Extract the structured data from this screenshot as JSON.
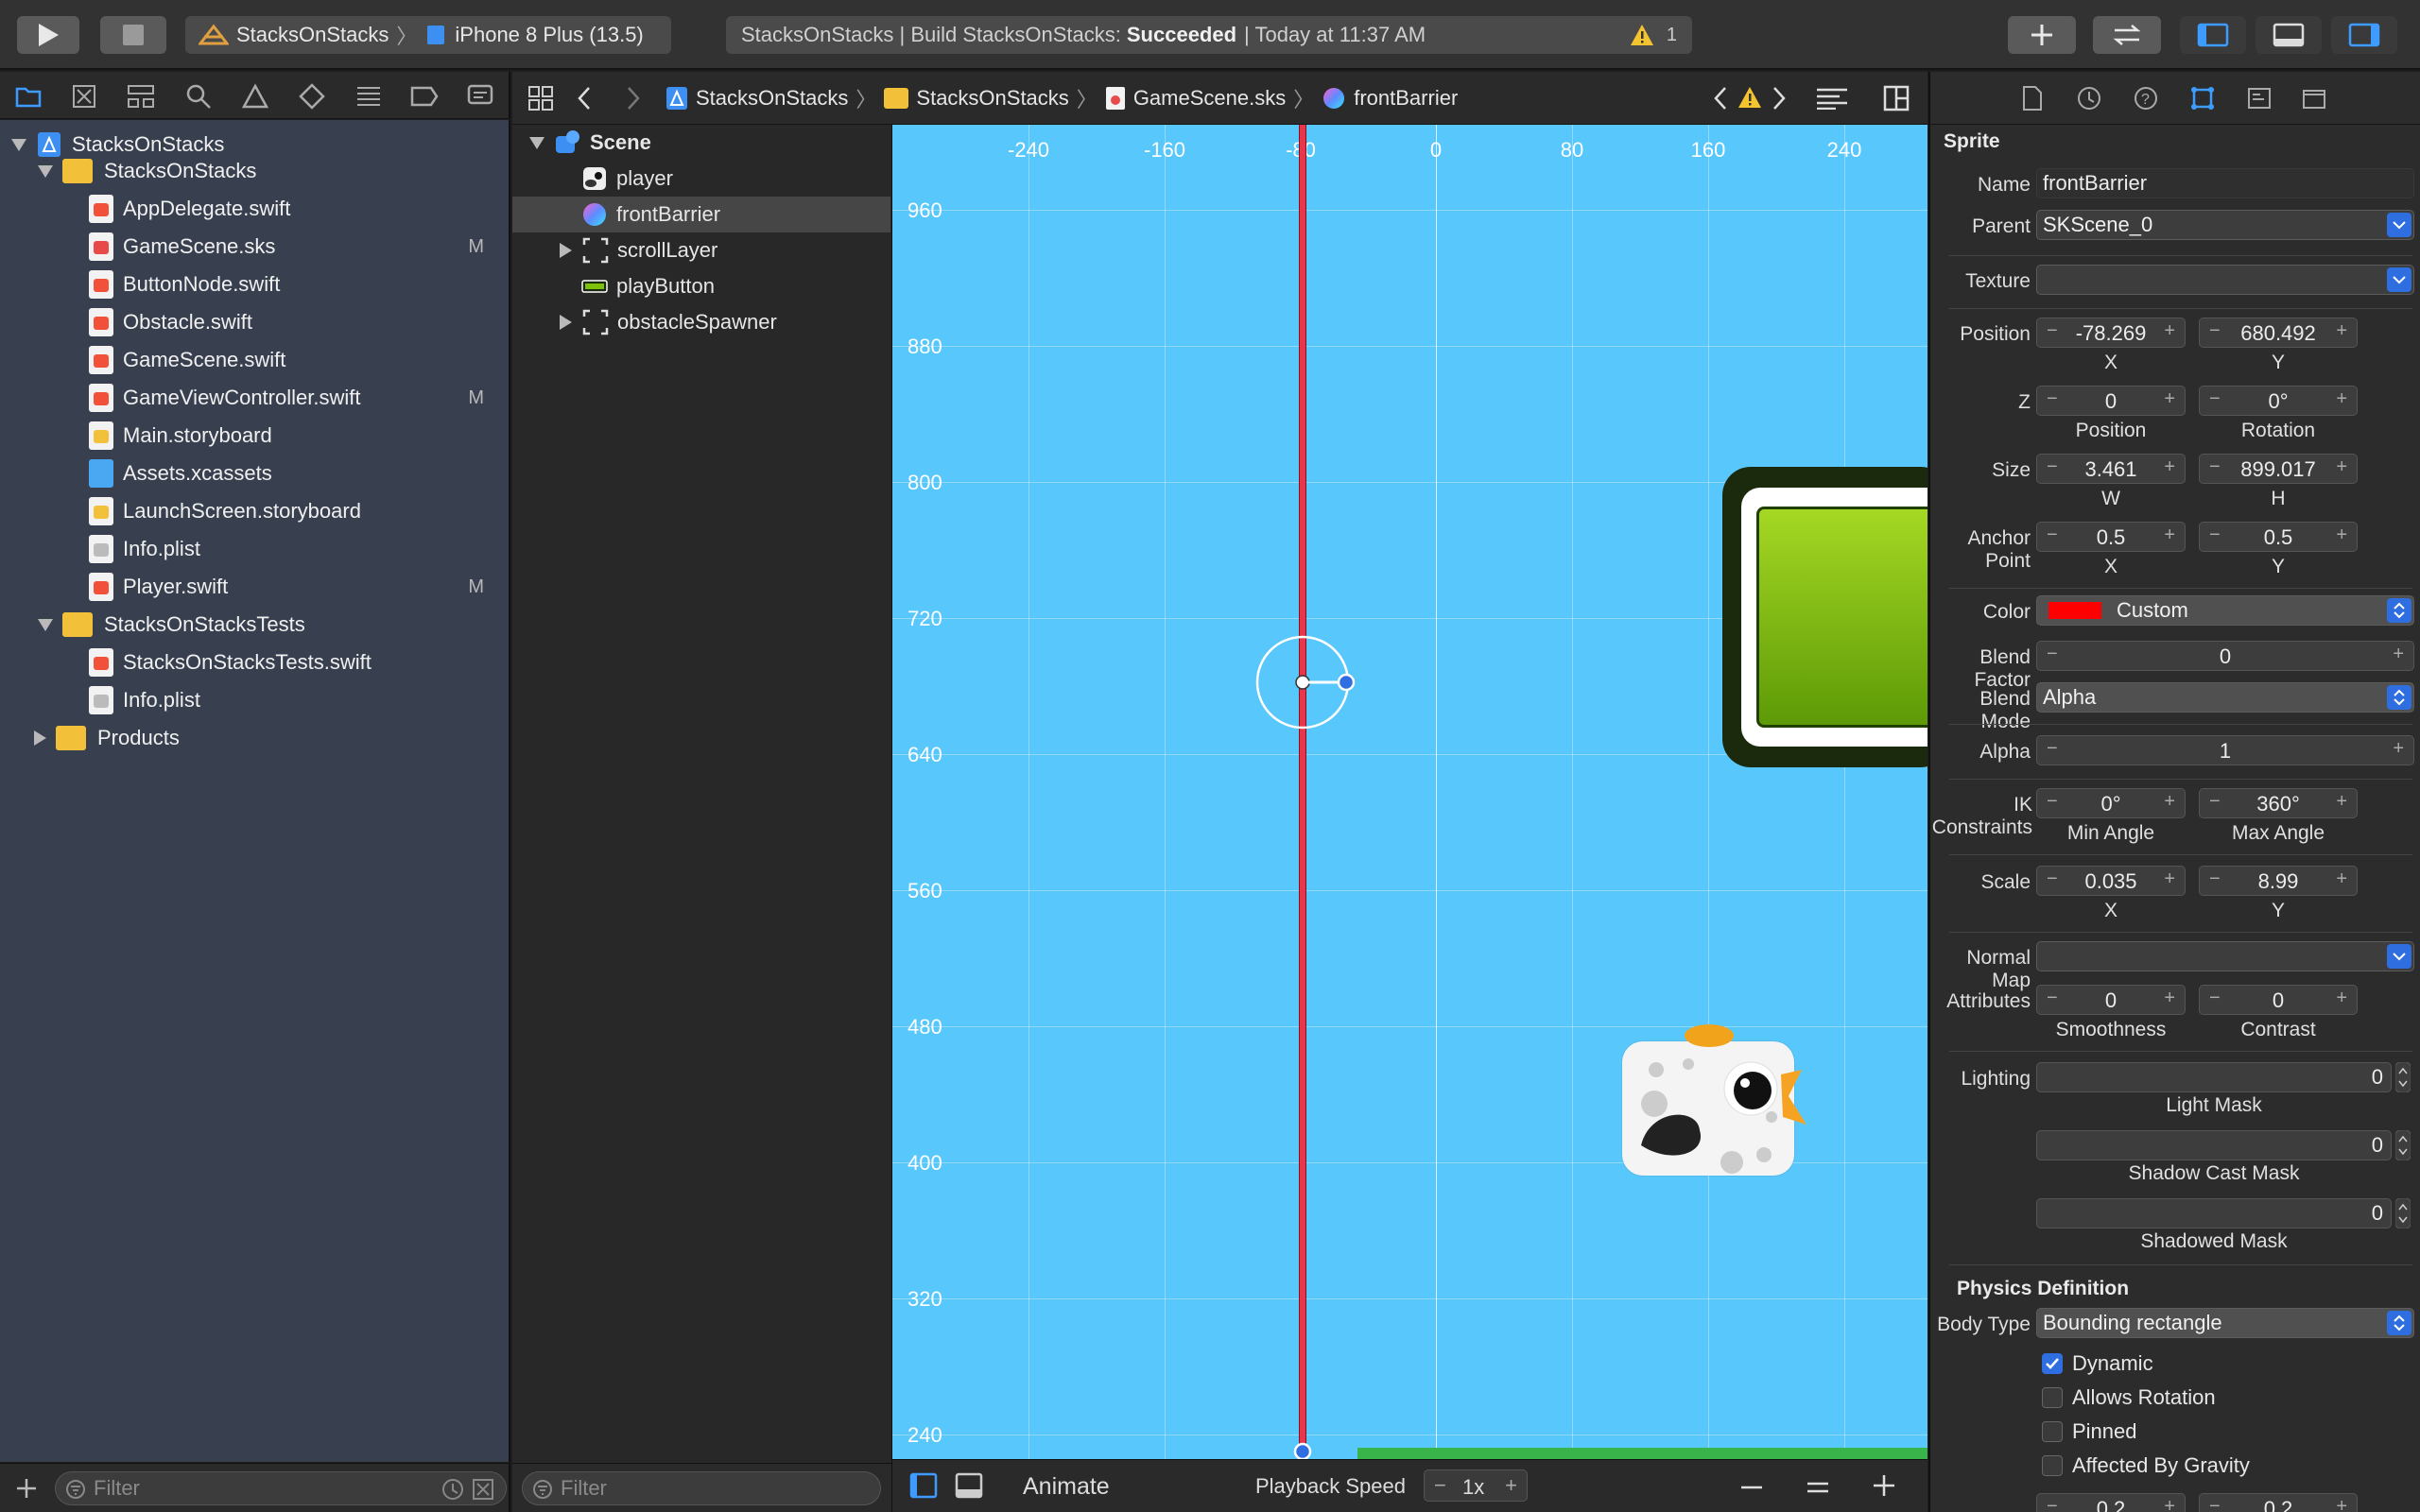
{
  "toolbar": {
    "scheme_target": "StacksOnStacks",
    "device": "iPhone 8 Plus (13.5)",
    "status_prefix": "StacksOnStacks | Build StacksOnStacks:",
    "status_result": "Succeeded",
    "status_time": "| Today at 11:37 AM",
    "warning_count": "1"
  },
  "navigator": {
    "project": "StacksOnStacks",
    "items": [
      {
        "label": "StacksOnStacks",
        "kind": "folder",
        "mark": ""
      },
      {
        "label": "AppDelegate.swift",
        "kind": "swift",
        "mark": ""
      },
      {
        "label": "GameScene.sks",
        "kind": "sks",
        "mark": "M"
      },
      {
        "label": "ButtonNode.swift",
        "kind": "swift",
        "mark": ""
      },
      {
        "label": "Obstacle.swift",
        "kind": "swift",
        "mark": ""
      },
      {
        "label": "GameScene.swift",
        "kind": "swift",
        "mark": ""
      },
      {
        "label": "GameViewController.swift",
        "kind": "swift",
        "mark": "M"
      },
      {
        "label": "Main.storyboard",
        "kind": "storyboard",
        "mark": ""
      },
      {
        "label": "Assets.xcassets",
        "kind": "assets",
        "mark": ""
      },
      {
        "label": "LaunchScreen.storyboard",
        "kind": "storyboard",
        "mark": ""
      },
      {
        "label": "Info.plist",
        "kind": "plist",
        "mark": ""
      },
      {
        "label": "Player.swift",
        "kind": "swift",
        "mark": "M"
      },
      {
        "label": "StacksOnStacksTests",
        "kind": "folder",
        "mark": ""
      },
      {
        "label": "StacksOnStacksTests.swift",
        "kind": "swift",
        "mark": ""
      },
      {
        "label": "Info.plist",
        "kind": "plist",
        "mark": ""
      },
      {
        "label": "Products",
        "kind": "folder",
        "mark": ""
      }
    ],
    "filter_placeholder": "Filter"
  },
  "jumpbar": {
    "crumbs": [
      "StacksOnStacks",
      "StacksOnStacks",
      "GameScene.sks",
      "frontBarrier"
    ]
  },
  "outline": {
    "root": "Scene",
    "nodes": [
      "player",
      "frontBarrier",
      "scrollLayer",
      "playButton",
      "obstacleSpawner"
    ],
    "filter_placeholder": "Filter"
  },
  "canvas": {
    "x_ticks": [
      "-240",
      "-160",
      "-80",
      "0",
      "80",
      "160",
      "240"
    ],
    "y_ticks": [
      "960",
      "880",
      "800",
      "720",
      "640",
      "560",
      "480",
      "400",
      "320",
      "240"
    ],
    "colors": {
      "background": "#58c7fb",
      "barrier": "#e8374a",
      "ground": "#38b44a"
    }
  },
  "editor_bottom": {
    "animate": "Animate",
    "playback_label": "Playback Speed",
    "playback_value": "1x"
  },
  "inspector": {
    "section": "Sprite",
    "name_label": "Name",
    "name": "frontBarrier",
    "parent_label": "Parent",
    "parent": "SKScene_0",
    "texture_label": "Texture",
    "position_label": "Position",
    "pos_x": "-78.269",
    "pos_y": "680.492",
    "x": "X",
    "y": "Y",
    "z_label": "Z",
    "z_position": "0",
    "z_rotation": "0°",
    "position_sub": "Position",
    "rotation_sub": "Rotation",
    "size_label": "Size",
    "size_w": "3.461",
    "size_h": "899.017",
    "w": "W",
    "h": "H",
    "anchor_label": "Anchor Point",
    "anchor_x": "0.5",
    "anchor_y": "0.5",
    "color_label": "Color",
    "color_name": "Custom",
    "color_swatch": "#ff0000",
    "blend_factor_label": "Blend Factor",
    "blend_factor": "0",
    "blend_mode_label": "Blend Mode",
    "blend_mode": "Alpha",
    "alpha_label": "Alpha",
    "alpha": "1",
    "ik_label": "IK Constraints",
    "ik_min": "0°",
    "ik_max": "360°",
    "min_angle": "Min Angle",
    "max_angle": "Max Angle",
    "scale_label": "Scale",
    "scale_x": "0.035",
    "scale_y": "8.99",
    "normal_map_label": "Normal Map",
    "attributes_label": "Attributes",
    "smoothness": "0",
    "contrast": "0",
    "smoothness_sub": "Smoothness",
    "contrast_sub": "Contrast",
    "lighting_label": "Lighting",
    "light_mask": "0",
    "light_mask_sub": "Light Mask",
    "shadow_cast": "0",
    "shadow_cast_sub": "Shadow Cast Mask",
    "shadowed": "0",
    "shadowed_sub": "Shadowed Mask",
    "physics_head": "Physics Definition",
    "body_type_label": "Body Type",
    "body_type": "Bounding rectangle",
    "dynamic": "Dynamic",
    "allows_rotation": "Allows Rotation",
    "pinned": "Pinned",
    "gravity": "Affected By Gravity",
    "bottom_a": "0.2",
    "bottom_b": "0.2"
  }
}
